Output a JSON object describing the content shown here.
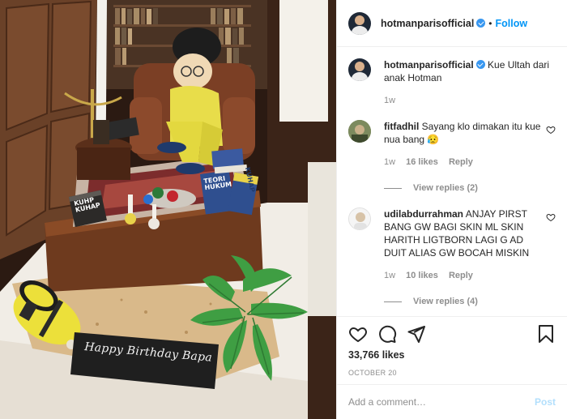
{
  "photo": {
    "card_text": "Happy Birthday Bapa",
    "book1": "KUHP KUHAP",
    "book2": "TEORI HUKUM",
    "book3": "KUHAP"
  },
  "header": {
    "username": "hotmanparisofficial",
    "dot": "•",
    "follow_label": "Follow"
  },
  "caption": {
    "username": "hotmanparisofficial",
    "text": " Kue Ultah dari anak Hotman",
    "time": "1w"
  },
  "comments": [
    {
      "username": "fitfadhil",
      "text": " Sayang klo dimakan itu kue nua bang 😥",
      "time": "1w",
      "likes": "16 likes",
      "reply": "Reply",
      "view_replies": "View replies (2)"
    },
    {
      "username": "udilabdurrahman",
      "text": " ANJAY PIRST BANG GW BAGI SKIN ML SKIN HARITH LIGTBORN LAGI G AD DUIT ALIAS GW BOCAH MISKIN",
      "time": "1w",
      "likes": "10 likes",
      "reply": "Reply",
      "view_replies": "View replies (4)"
    }
  ],
  "actions": {
    "icons": [
      "heart-icon",
      "comment-icon",
      "share-icon",
      "bookmark-icon"
    ],
    "likes": "33,766 likes",
    "date": "OCTOBER 20"
  },
  "add_comment": {
    "placeholder": "Add a comment…",
    "post_label": "Post"
  },
  "colors": {
    "accent": "#0095f6",
    "verified": "#3897f0",
    "muted": "#8e8e8e"
  }
}
